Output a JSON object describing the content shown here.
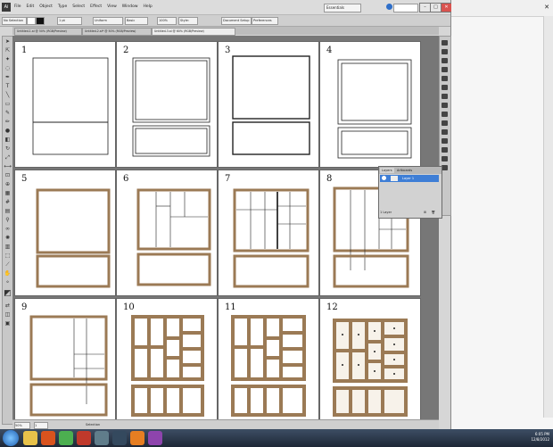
{
  "app": {
    "logo": "Ai",
    "menus": [
      "File",
      "Edit",
      "Object",
      "Type",
      "Select",
      "Effect",
      "View",
      "Window",
      "Help"
    ],
    "workspace": "Essentials",
    "window_buttons": [
      "–",
      "□",
      "✕"
    ]
  },
  "options_bar": {
    "selection": "No Selection",
    "stroke": "1 pt",
    "profile": "Uniform",
    "brush": "Basic",
    "opacity": "100%",
    "style": "Style:",
    "document_setup": "Document Setup",
    "preferences": "Preferences"
  },
  "document_tabs": [
    "Untitled-1.ai @ 50% (RGB/Preview)",
    "Untitled-2.ai* @ 50% (RGB/Preview)",
    "Untitled-3.ai @ 60% (RGB/Preview)"
  ],
  "artboards": [
    "1",
    "2",
    "3",
    "4",
    "5",
    "6",
    "7",
    "8",
    "9",
    "10",
    "11",
    "12"
  ],
  "layers_panel": {
    "tabs": [
      "Layers",
      "Artboards"
    ],
    "layer_name": "Layer 1",
    "footer": "1 Layer"
  },
  "status": {
    "zoom": "50%",
    "artboard": "1",
    "tool": "Selection"
  },
  "taskbar": {
    "time": "6:05 PM",
    "date": "12/8/2012"
  },
  "colors": {
    "wood": "#9b7a55",
    "wood_dark": "#7a5d3d",
    "accent": "#3e7ed6"
  }
}
